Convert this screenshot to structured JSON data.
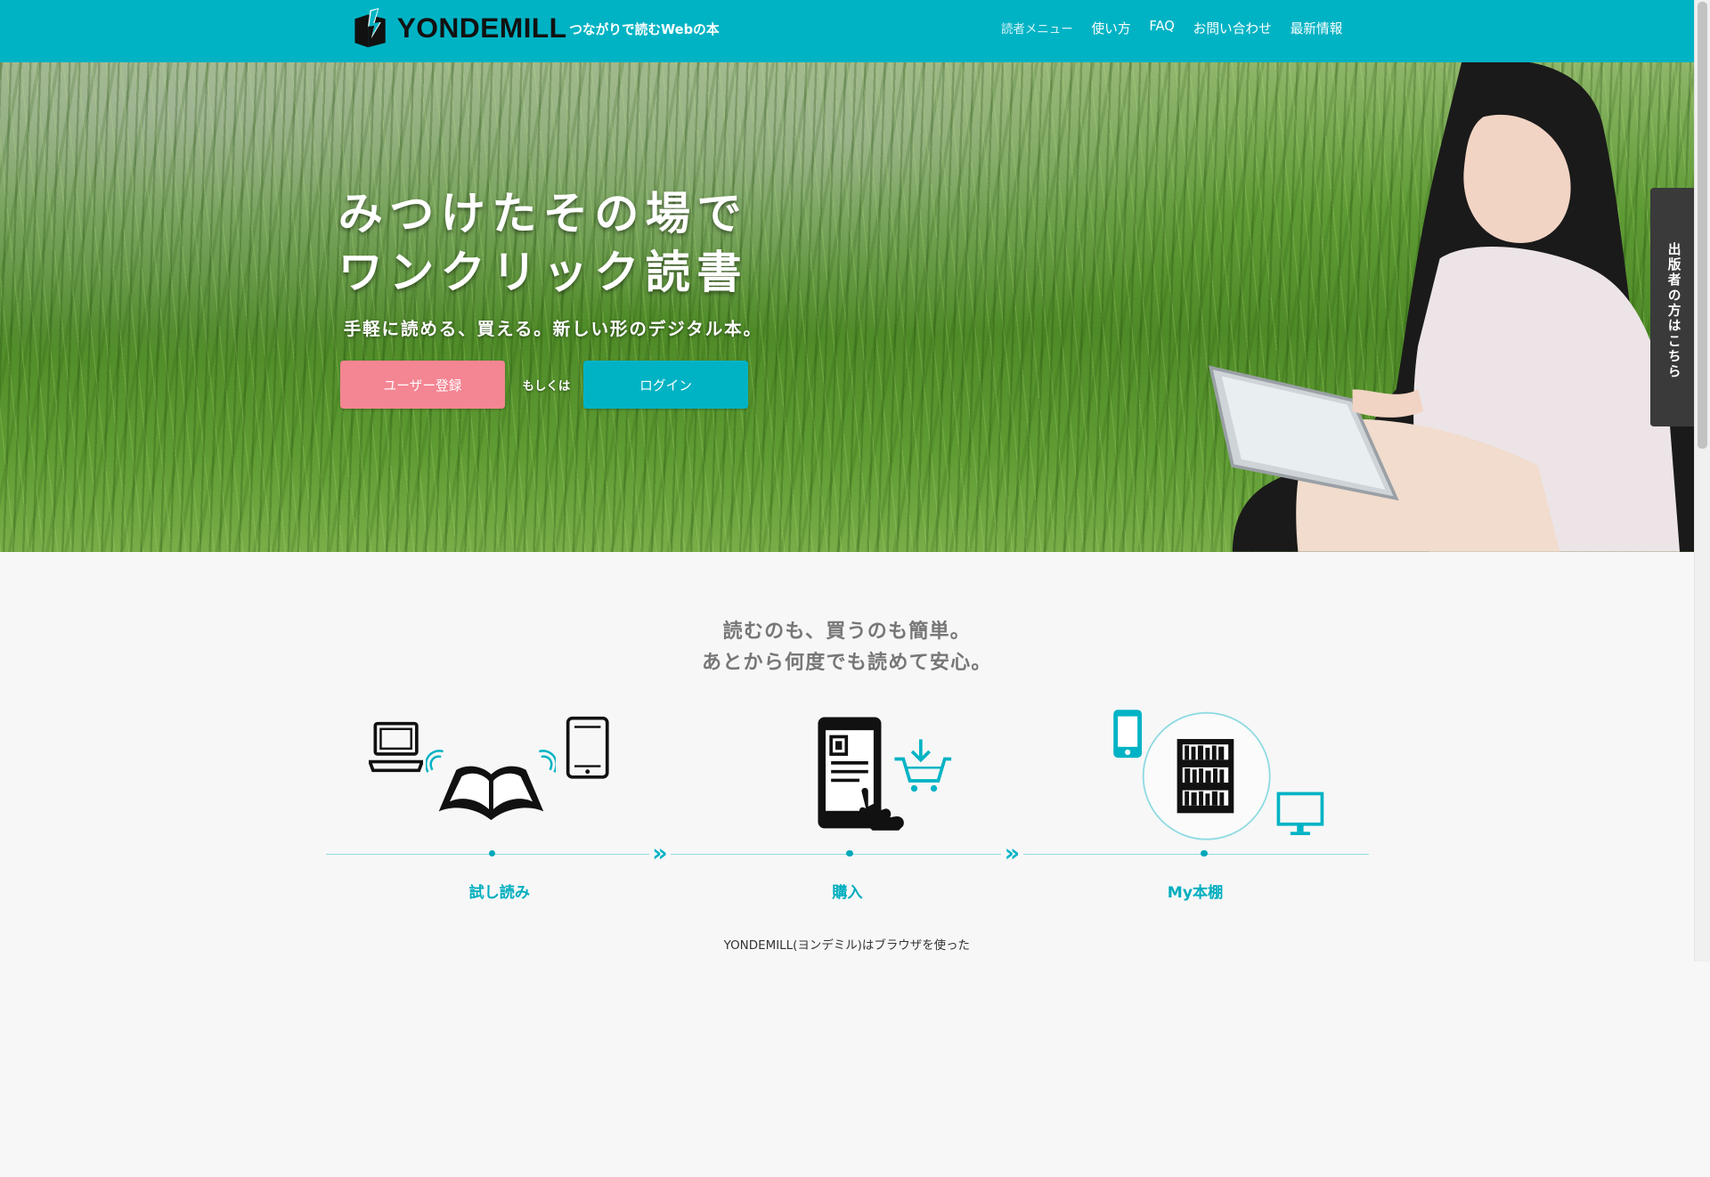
{
  "brand": {
    "name": "YONDEMILL",
    "tagline": "つながりで読むWebの本"
  },
  "nav": {
    "items": [
      "読者メニュー",
      "使い方",
      "FAQ",
      "お問い合わせ",
      "最新情報"
    ]
  },
  "hero": {
    "title_line1": "みつけたその場で",
    "title_line2": "ワンクリック読書",
    "subtitle": "手軽に読める、買える。新しい形のデジタル本。",
    "register_label": "ユーザー登録",
    "or_label": "もしくは",
    "login_label": "ログイン"
  },
  "side_tab": {
    "label": "出版者の方はこちら"
  },
  "features": {
    "lead_line1": "読むのも、買うのも簡単。",
    "lead_line2": "あとから何度でも読めて安心。",
    "steps": [
      "試し読み",
      "購入",
      "My本棚"
    ],
    "arrow_glyph": "»"
  },
  "bottom": {
    "line1": "YONDEMILL(ヨンデミル)はブラウザを使った"
  },
  "colors": {
    "accent": "#00b3c4",
    "register": "#f48593",
    "side_tab": "#3a3a3a"
  },
  "icons": [
    "logo-mark-icon",
    "laptop-icon",
    "open-book-icon",
    "tablet-icon",
    "phone-tap-icon",
    "cart-download-icon",
    "smartphone-icon",
    "bookshelf-icon",
    "monitor-icon"
  ]
}
